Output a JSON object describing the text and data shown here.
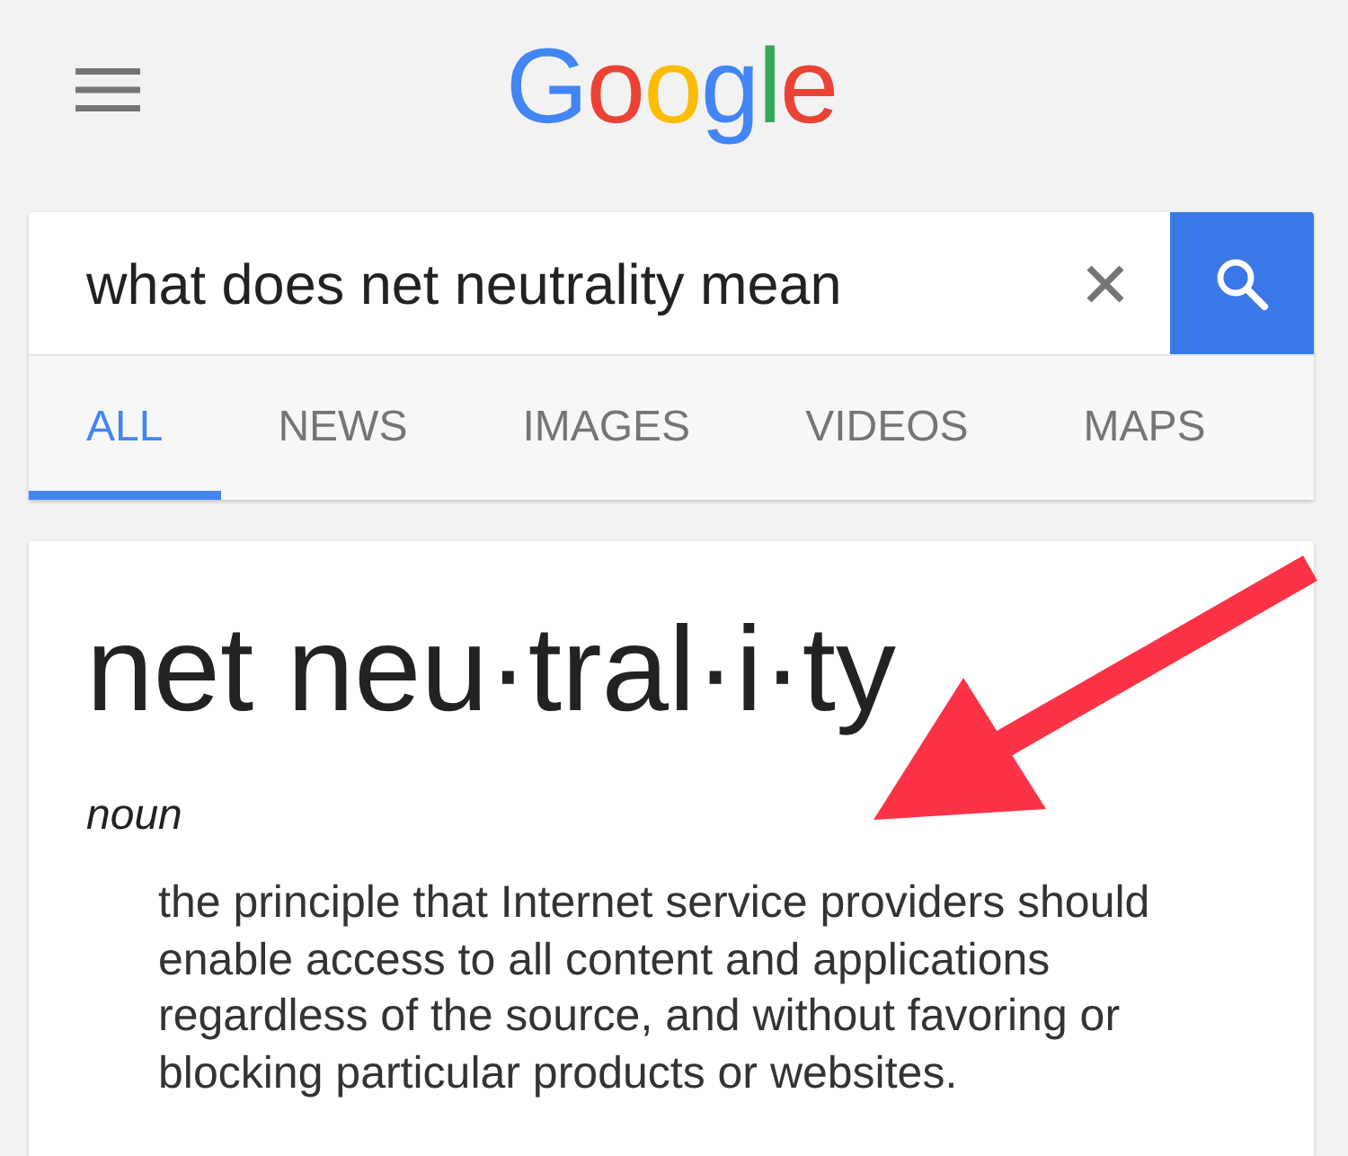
{
  "header": {
    "logo": "Google"
  },
  "search": {
    "value": "what does net neutrality mean"
  },
  "tabs": [
    {
      "label": "ALL",
      "selected": true
    },
    {
      "label": "NEWS",
      "selected": false
    },
    {
      "label": "IMAGES",
      "selected": false
    },
    {
      "label": "VIDEOS",
      "selected": false
    },
    {
      "label": "MAPS",
      "selected": false
    }
  ],
  "definition": {
    "word": "net neu·tral·i·ty",
    "part_of_speech": "noun",
    "meaning": "the principle that Internet service providers should enable access to all content and applications regardless of the source, and without favoring or blocking particular products or websites."
  }
}
